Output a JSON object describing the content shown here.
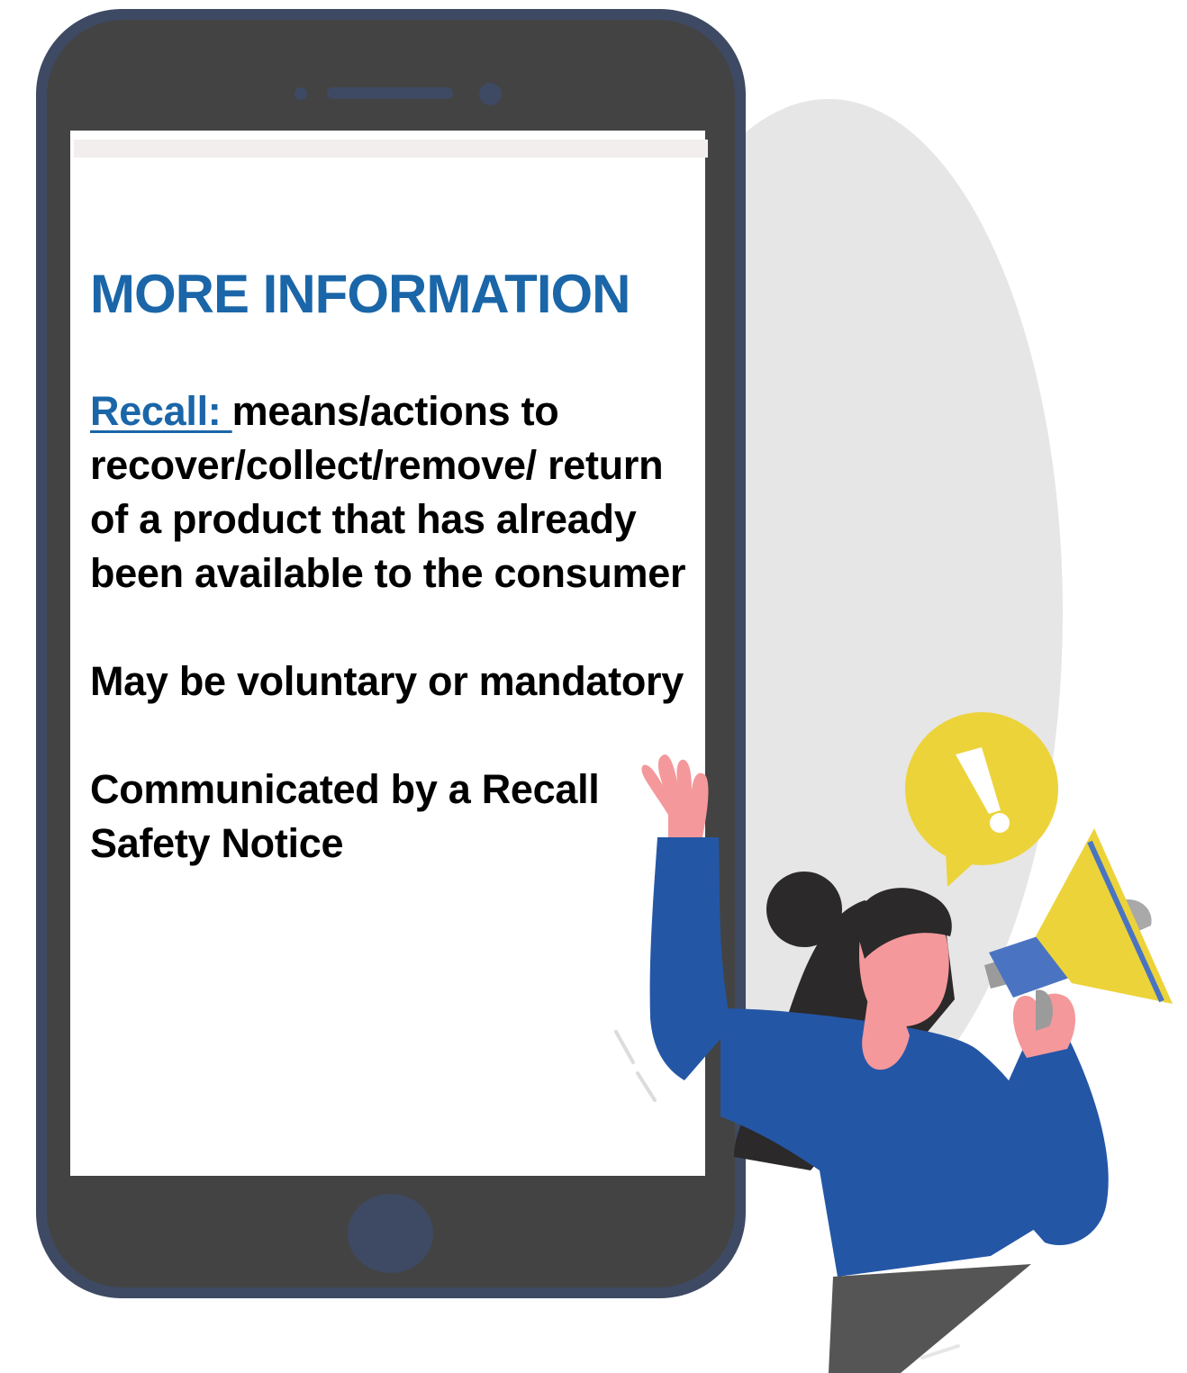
{
  "screen": {
    "heading": "MORE INFORMATION",
    "definition": {
      "term": "Recall: ",
      "text": "means/actions to recover/collect/remove/ return of a product that has already been available to the consumer"
    },
    "point_2": "May be voluntary or mandatory",
    "point_3": "Communicated by a Recall Safety Notice"
  },
  "colors": {
    "heading": "#1a66a8",
    "phone_frame": "#3e4a63",
    "phone_body": "#434343",
    "shirt": "#2456a6",
    "speech_bubble": "#ecd33a",
    "megaphone": "#ecd33a",
    "skin": "#f4989b"
  },
  "icons": [
    "exclamation-icon",
    "megaphone-icon"
  ]
}
